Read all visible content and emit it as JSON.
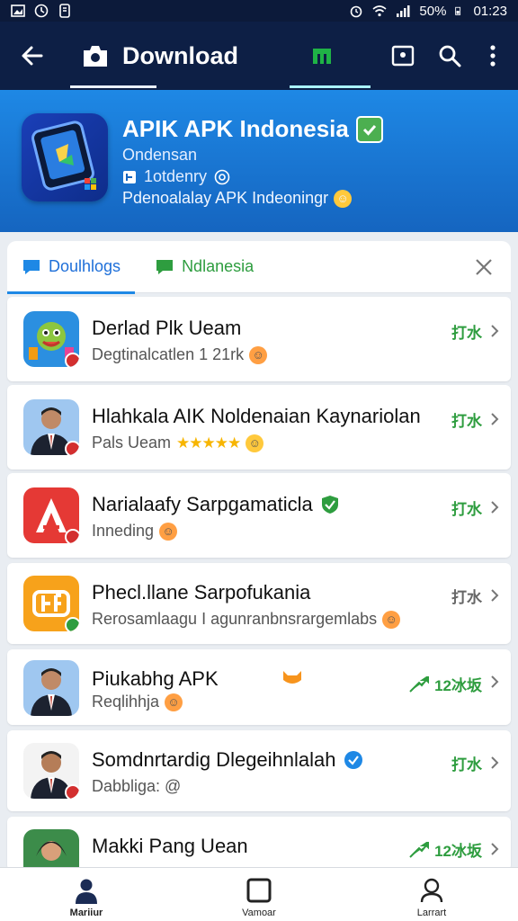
{
  "status_bar": {
    "battery": "50%",
    "time": "01:23"
  },
  "app_bar": {
    "title": "Download"
  },
  "banner": {
    "title": "APIK APK Indonesia",
    "subtitle": "Ondensan",
    "meta": "1otdenry",
    "description": "Pdenoalalay APK Indeoningr"
  },
  "tabs": [
    {
      "label": "Doulhlogs"
    },
    {
      "label": "Ndlanesia"
    }
  ],
  "apps": [
    {
      "name": "Derlad Plk Ueam",
      "sub": "Degtinalcatlen 1 21rk",
      "status": "打水"
    },
    {
      "name": "Hlahkala AIK Noldenaian Kaynariolan",
      "sub": "Pals Ueam",
      "stars": "★★★★★",
      "status": "打水"
    },
    {
      "name": "Narialaafy Sarpgamaticla",
      "sub": "Inneding",
      "status": "打水"
    },
    {
      "name": "Phecl.llane Sarpofukania",
      "sub": "Rerosamlaagu I agunranbnsrargemlabs",
      "status": "打水"
    },
    {
      "name": "Piukabhg APK",
      "sub": "Reqlihhja",
      "status": "12冰坂"
    },
    {
      "name": "Somdnrtardig Dlegeihnlalah",
      "sub": "Dabbliga: @",
      "status": "打水"
    },
    {
      "name": "Makki Pang Uean",
      "sub": "",
      "status": "12冰坂"
    }
  ],
  "bottom_nav": [
    {
      "label": "Mariiur"
    },
    {
      "label": "Vamoar"
    },
    {
      "label": "Larrart"
    }
  ],
  "colors": {
    "app_bar": "#0d1f45",
    "banner": "#1e88e5",
    "accent_green": "#2e9d3f",
    "accent_blue": "#1e6fd9"
  }
}
